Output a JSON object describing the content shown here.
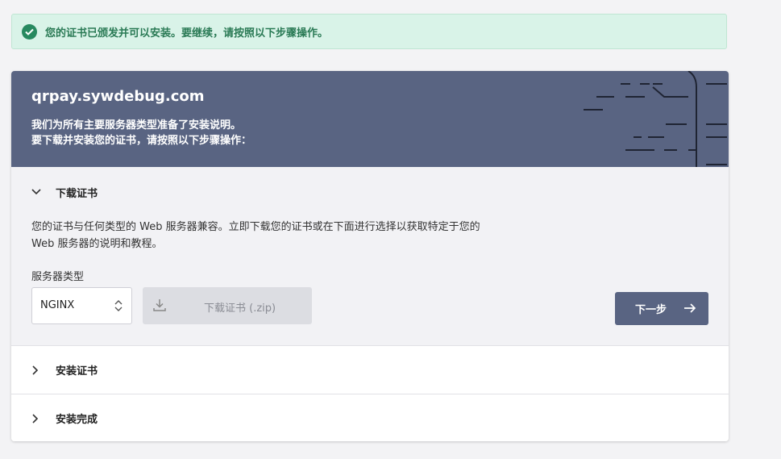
{
  "alert": {
    "icon": "check-circle-icon",
    "text": "您的证书已颁发并可以安装。要继续，请按照以下步骤操作。"
  },
  "card": {
    "domain": "qrpay.sywdebug.com",
    "subtitle_line1": "我们为所有主要服务器类型准备了安装说明。",
    "subtitle_line2": "要下载并安装您的证书，请按照以下步骤操作："
  },
  "steps": [
    {
      "title": "下载证书",
      "expanded": true,
      "description_line1": "您的证书与任何类型的 Web 服务器兼容。立即下载您的证书或在下面进行选择以获取特定于您的",
      "description_line2": "Web 服务器的说明和教程。",
      "server_type_label": "服务器类型",
      "server_type_value": "NGINX",
      "download_label": "下载证书 (.zip)",
      "next_label": "下一步"
    },
    {
      "title": "安装证书",
      "expanded": false
    },
    {
      "title": "安装完成",
      "expanded": false
    }
  ],
  "colors": {
    "header_bg": "#596482",
    "alert_bg": "#d9f3e8",
    "alert_text": "#2a7a55",
    "check": "#27895f",
    "button_primary": "#596482",
    "button_disabled": "#dcdde2"
  }
}
